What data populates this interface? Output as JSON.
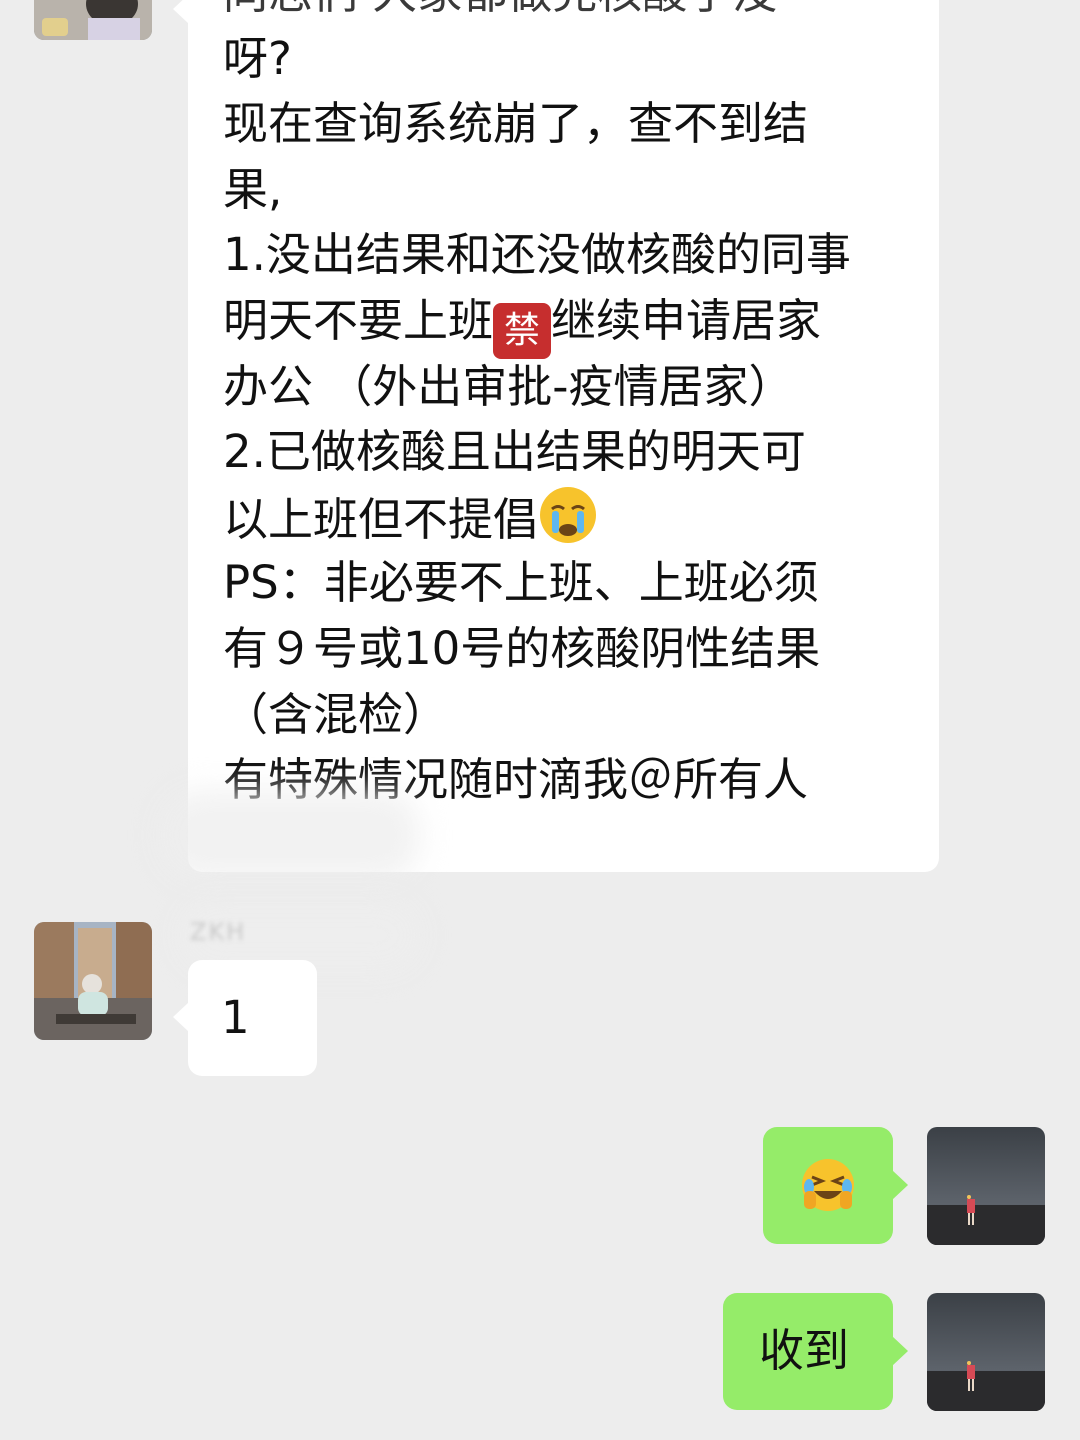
{
  "messages": [
    {
      "direction": "incoming",
      "lines": [
        "同志们 大家都做完核酸了没",
        "呀?",
        "现在查询系统崩了，查不到结",
        "果,",
        "1.没出结果和还没做核酸的同事",
        "明天不要上班|继续申请居家",
        "办公 （外出审批-疫情居家）",
        "2.已做核酸且出结果的明天可",
        "以上班但不提倡",
        "PS：非必要不上班、上班必须",
        "有９号或10号的核酸阴性结果",
        "（含混检）",
        "有特殊情况随时滴我＠所有人"
      ],
      "inline_emoji": {
        "ban_char": "禁",
        "crying": "crying-face-emoji"
      }
    },
    {
      "direction": "incoming",
      "sender": "ZKH",
      "text": "1"
    },
    {
      "direction": "outgoing",
      "emoji": "laughing-crying-face-emoji"
    },
    {
      "direction": "outgoing",
      "text": "收到"
    }
  ],
  "colors": {
    "background": "#ededed",
    "incoming_bubble": "#ffffff",
    "outgoing_bubble": "#95ec69",
    "text": "#111111"
  }
}
